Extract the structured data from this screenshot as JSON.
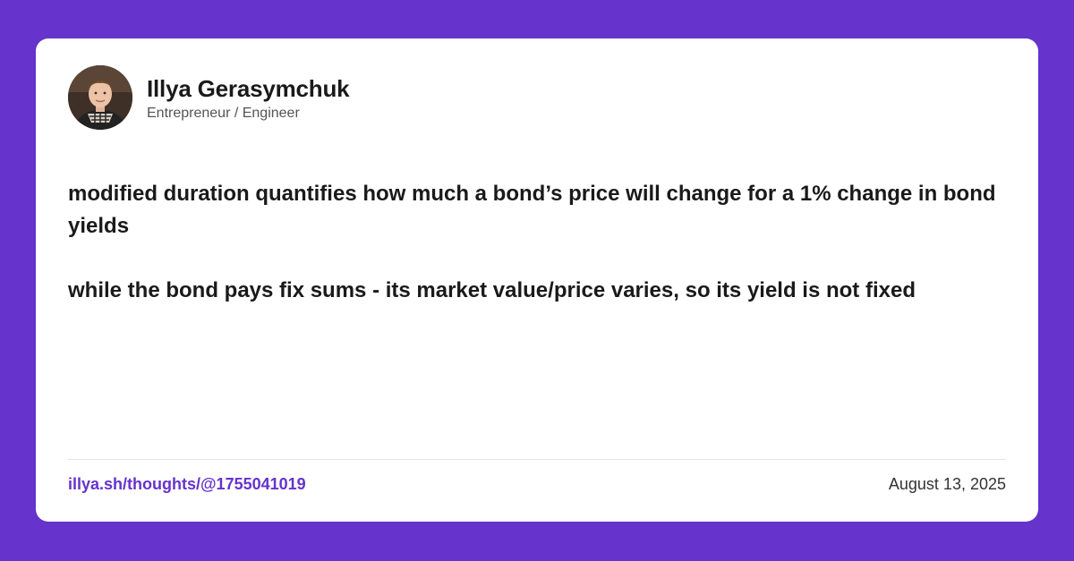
{
  "colors": {
    "background": "#6633cc",
    "card": "#ffffff",
    "link": "#6633cc",
    "text": "#1a1a1a"
  },
  "author": {
    "name": "Illya Gerasymchuk",
    "role": "Entrepreneur / Engineer",
    "avatar_icon": "profile-photo"
  },
  "post": {
    "paragraphs": [
      "modified duration quantifies how much a bond’s price will change for a 1% change in bond yields",
      "while the bond pays fix sums - its market value/price varies, so its yield is not fixed"
    ]
  },
  "footer": {
    "link_text": "illya.sh/thoughts/@1755041019",
    "date": "August 13, 2025"
  }
}
